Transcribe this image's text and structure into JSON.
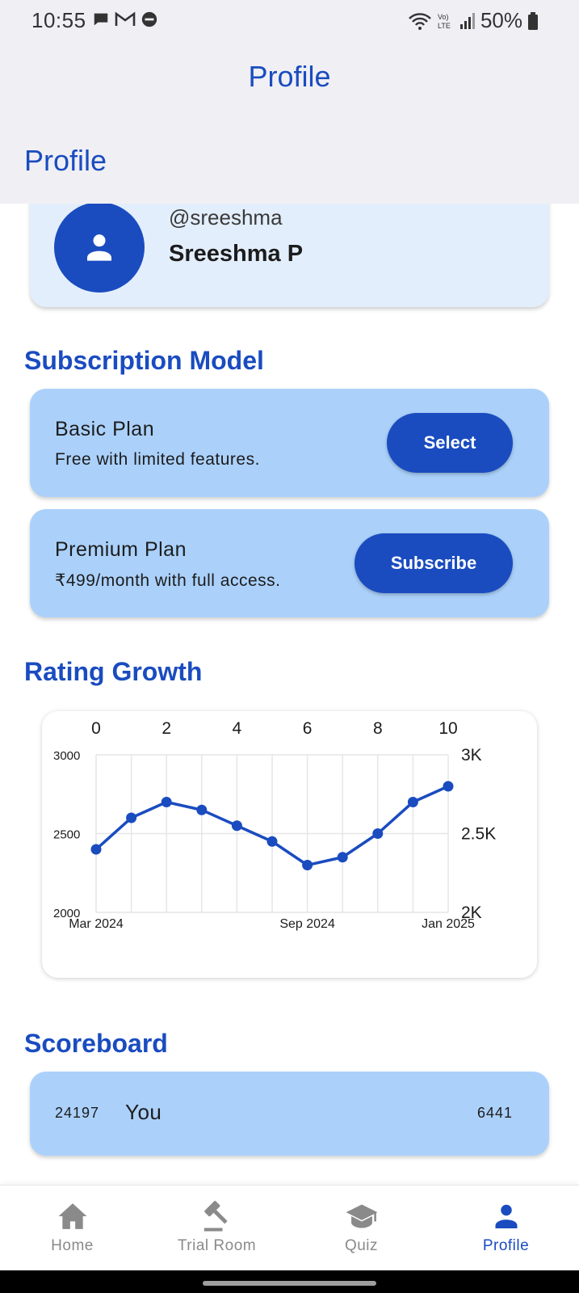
{
  "status_bar": {
    "time": "10:55",
    "battery": "50%"
  },
  "app_bar": {
    "title": "Profile"
  },
  "page_header": "Profile",
  "profile": {
    "handle": "@sreeshma",
    "name": "Sreeshma P"
  },
  "subscription": {
    "title": "Subscription Model",
    "plans": [
      {
        "name": "Basic Plan",
        "description": "Free with limited features.",
        "button": "Select"
      },
      {
        "name": "Premium Plan",
        "description": "₹499/month with full access.",
        "button": "Subscribe"
      }
    ]
  },
  "rating": {
    "title": "Rating Growth"
  },
  "chart_data": {
    "type": "line",
    "title": "",
    "x": [
      0,
      1,
      2,
      3,
      4,
      5,
      6,
      7,
      8,
      9,
      10
    ],
    "series": [
      {
        "values": [
          2400,
          2600,
          2700,
          2650,
          2550,
          2450,
          2300,
          2350,
          2500,
          2700,
          2800
        ]
      }
    ],
    "xlim": [
      0,
      10
    ],
    "ylim": [
      2000,
      3000
    ],
    "top_ticks": [
      "0",
      "2",
      "4",
      "6",
      "8",
      "10"
    ],
    "bottom_ticks": [
      "Mar 2024",
      "Sep 2024",
      "Jan 2025"
    ],
    "left_ticks": [
      "3000",
      "2500",
      "2000"
    ],
    "right_ticks": [
      "3K",
      "2.5K",
      "2K"
    ],
    "grid": true,
    "color": "#1a4cc0"
  },
  "scoreboard": {
    "title": "Scoreboard",
    "rank": "24197",
    "name": "You",
    "score": "6441"
  },
  "nav": {
    "items": [
      {
        "label": "Home",
        "icon": "home-icon"
      },
      {
        "label": "Trial Room",
        "icon": "gavel-icon"
      },
      {
        "label": "Quiz",
        "icon": "school-icon"
      },
      {
        "label": "Profile",
        "icon": "person-icon"
      }
    ],
    "active": "Profile"
  },
  "colors": {
    "accent": "#1a4cc0",
    "card": "#abd1fb",
    "profile_card": "#e3eefc",
    "header_bg": "#f0eff4"
  }
}
